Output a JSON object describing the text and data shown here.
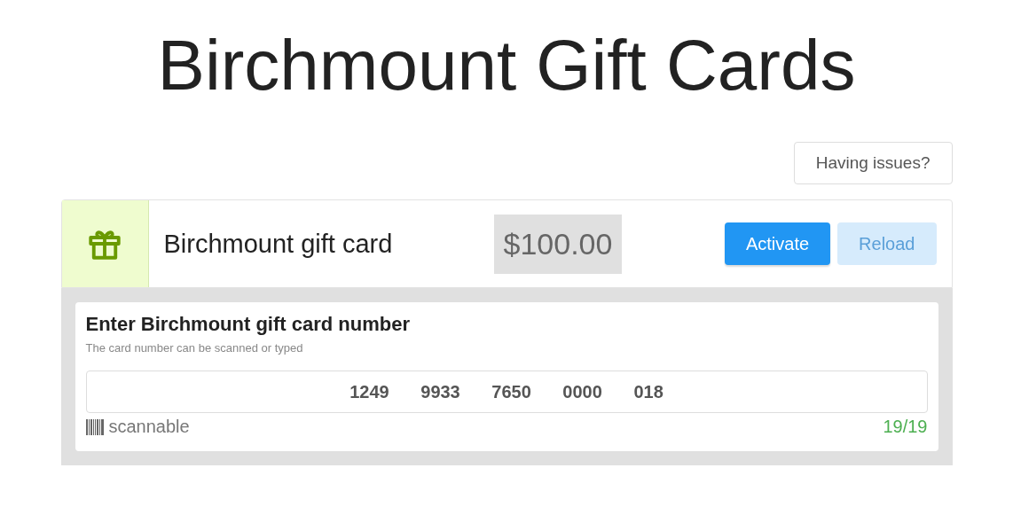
{
  "title": "Birchmount Gift Cards",
  "help_button": "Having issues?",
  "product": {
    "name": "Birchmount gift card",
    "price": "$100.00"
  },
  "actions": [
    {
      "label": "Activate",
      "disabled": false
    },
    {
      "label": "Reload",
      "disabled": true
    }
  ],
  "card_entry": {
    "heading": "Enter Birchmount gift card number",
    "hint": "The card number can be scanned or typed",
    "value": "1249 9933 7650 0000 018",
    "scan_label": "scannable",
    "counter": "19/19"
  }
}
